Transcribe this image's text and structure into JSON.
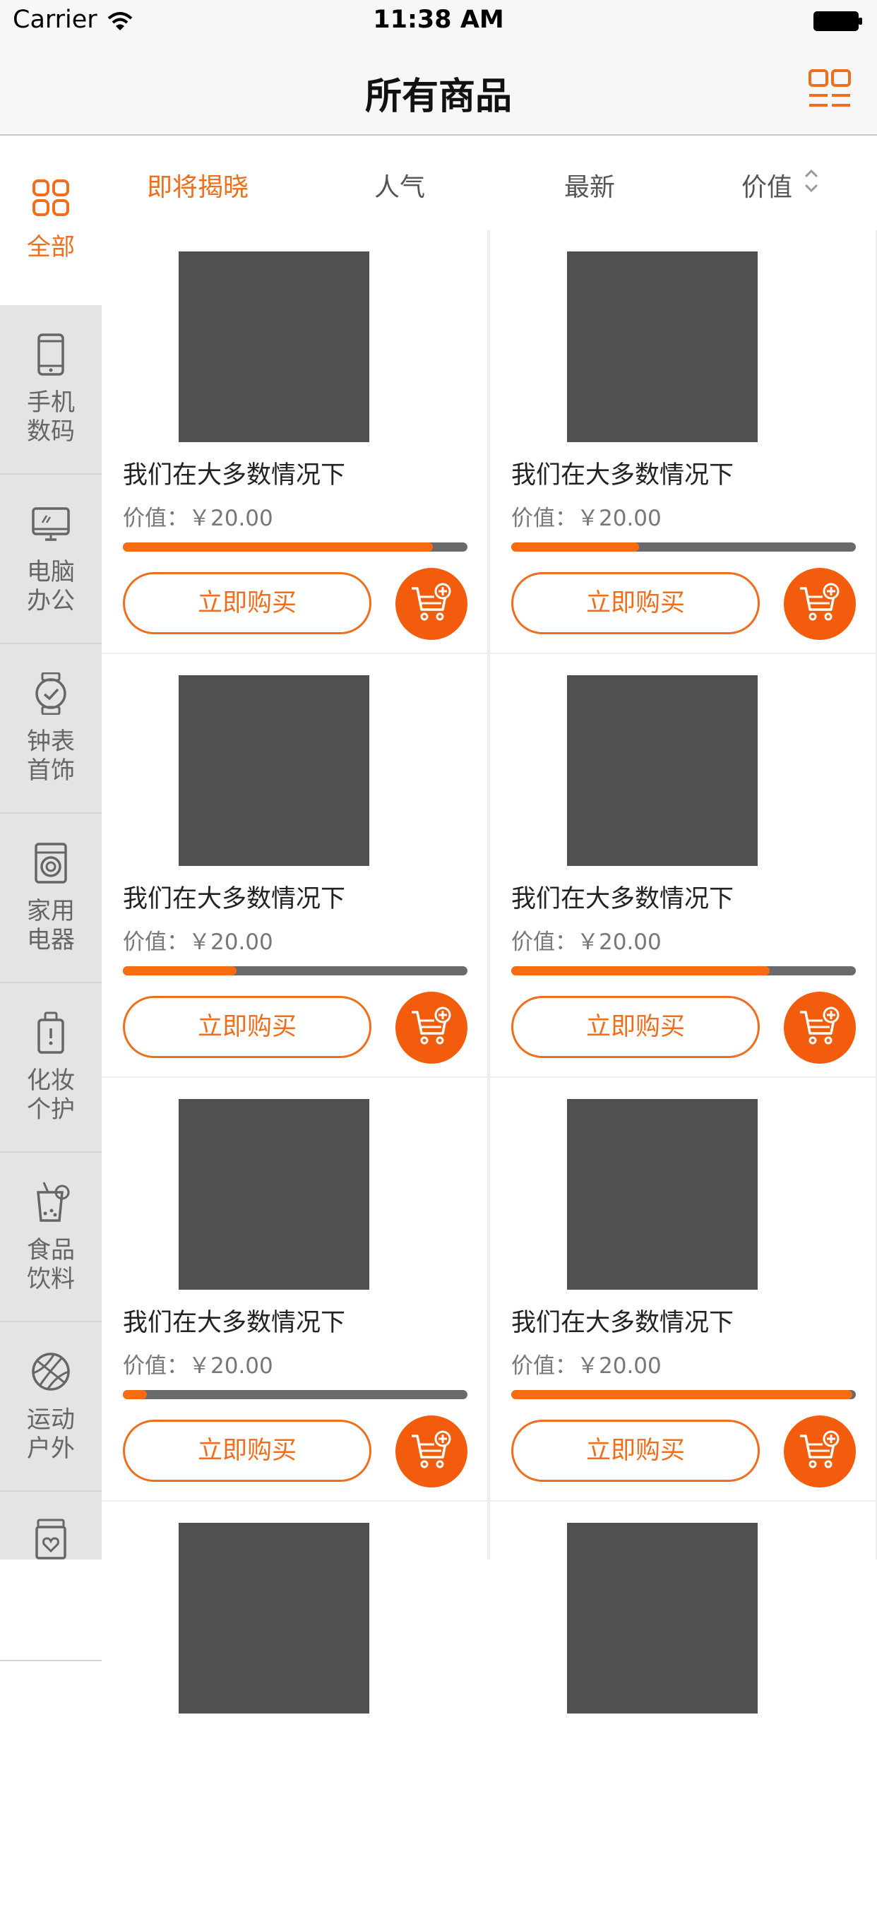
{
  "status_bar": {
    "carrier": "Carrier",
    "time": "11:38 AM"
  },
  "nav": {
    "title": "所有商品"
  },
  "sidebar": {
    "items": [
      {
        "label": "全部",
        "icon": "grid-icon",
        "active": true
      },
      {
        "label": "手机\n数码",
        "icon": "phone-icon",
        "active": false
      },
      {
        "label": "电脑\n办公",
        "icon": "monitor-icon",
        "active": false
      },
      {
        "label": "钟表\n首饰",
        "icon": "watch-icon",
        "active": false
      },
      {
        "label": "家用\n电器",
        "icon": "washing-machine-icon",
        "active": false
      },
      {
        "label": "化妆\n个护",
        "icon": "cosmetics-icon",
        "active": false
      },
      {
        "label": "食品\n饮料",
        "icon": "drink-icon",
        "active": false
      },
      {
        "label": "运动\n户外",
        "icon": "basketball-icon",
        "active": false
      },
      {
        "label": "",
        "icon": "jar-icon",
        "active": false
      }
    ]
  },
  "sort_tabs": [
    {
      "label": "即将揭晓",
      "active": true
    },
    {
      "label": "人气",
      "active": false
    },
    {
      "label": "最新",
      "active": false
    },
    {
      "label": "价值",
      "active": false,
      "has_sort_arrows": true
    }
  ],
  "products": [
    {
      "name": "我们在大多数情况下",
      "price": "价值：￥20.00",
      "progress": 0.9,
      "buy_label": "立即购买"
    },
    {
      "name": "我们在大多数情况下",
      "price": "价值：￥20.00",
      "progress": 0.37,
      "buy_label": "立即购买"
    },
    {
      "name": "我们在大多数情况下",
      "price": "价值：￥20.00",
      "progress": 0.33,
      "buy_label": "立即购买"
    },
    {
      "name": "我们在大多数情况下",
      "price": "价值：￥20.00",
      "progress": 0.75,
      "buy_label": "立即购买"
    },
    {
      "name": "我们在大多数情况下",
      "price": "价值：￥20.00",
      "progress": 0.07,
      "buy_label": "立即购买"
    },
    {
      "name": "我们在大多数情况下",
      "price": "价值：￥20.00",
      "progress": 0.99,
      "buy_label": "立即购买"
    },
    {
      "name": "",
      "price": "",
      "progress": null,
      "buy_label": ""
    },
    {
      "name": "",
      "price": "",
      "progress": null,
      "buy_label": ""
    }
  ],
  "colors": {
    "accent": "#f06d1b",
    "cart_button": "#f25c0c",
    "progress_track": "#6a6a6a",
    "image_placeholder": "#505050"
  }
}
